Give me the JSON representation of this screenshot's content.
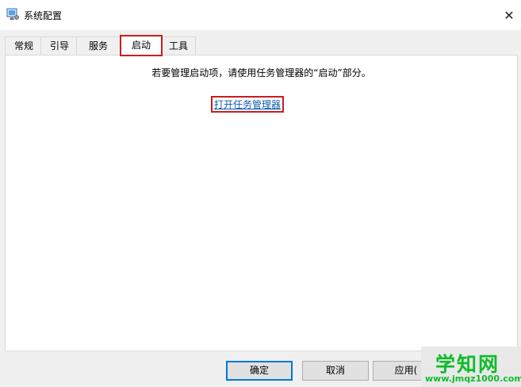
{
  "window": {
    "title": "系统配置",
    "close_label": "✕"
  },
  "tabs": [
    {
      "label": "常规"
    },
    {
      "label": "引导"
    },
    {
      "label": "服务"
    },
    {
      "label": "启动"
    },
    {
      "label": "工具"
    }
  ],
  "active_tab": "启动",
  "startup": {
    "instruction": "若要管理启动项，请使用任务管理器的“启动”部分。",
    "link_label": "打开任务管理器"
  },
  "buttons": {
    "ok": "确定",
    "cancel": "取消",
    "apply": "应用("
  },
  "watermark": {
    "brand": "学知网",
    "url": "www.jmqz1000.com"
  },
  "colors": {
    "highlight": "#c91d1d",
    "link": "#0b5cad",
    "default_button_border": "#0078d7",
    "watermark": "#0fbb2c"
  }
}
